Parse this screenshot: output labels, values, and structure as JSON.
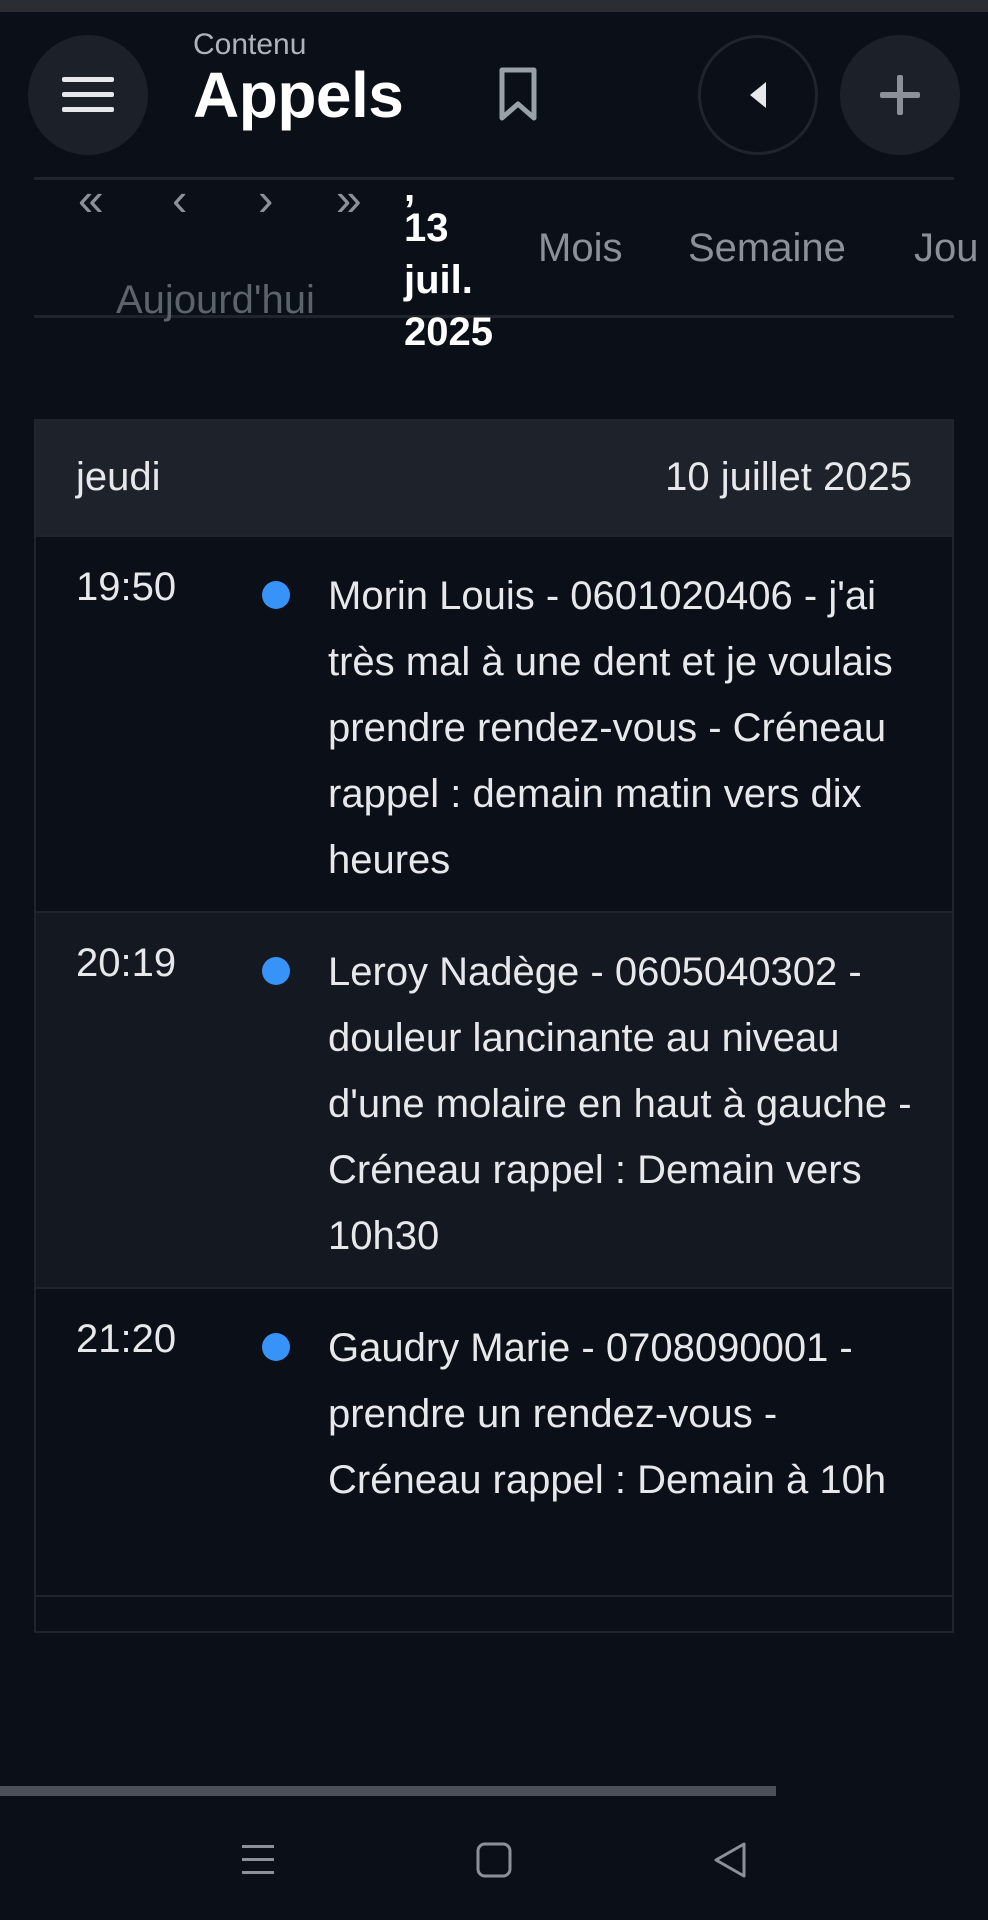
{
  "header": {
    "subtitle": "Contenu",
    "title": "Appels"
  },
  "calendar_toolbar": {
    "nav": {
      "prev_double": "«",
      "prev": "‹",
      "next": "›",
      "next_double": "»"
    },
    "today_label": "Aujourd'hui",
    "current_date_lines": [
      "13",
      "juil.",
      "2025"
    ],
    "views": [
      "Mois",
      "Semaine",
      "Jou"
    ]
  },
  "day": {
    "name": "jeudi",
    "date": "10 juillet 2025"
  },
  "events": [
    {
      "time": "19:50",
      "text": "Morin Louis - 0601020406 - j'ai très mal à une dent et je voulais prendre rendez-vous - Créneau rappel : demain matin vers dix heures"
    },
    {
      "time": "20:19",
      "text": "Leroy Nadège - 0605040302 - douleur lancinante au niveau d'une molaire en haut à gauche - Créneau rappel : Demain vers 10h30"
    },
    {
      "time": "21:20",
      "text": "Gaudry Marie - 0708090001 - prendre un rendez-vous - Créneau rappel : Demain à 10h"
    }
  ],
  "colors": {
    "background": "#0b0f17",
    "event_dot": "#3793f7",
    "header_row": "#1d222b"
  },
  "icons": {
    "menu": "hamburger-icon",
    "bookmark": "bookmark-icon",
    "back": "caret-left-icon",
    "add": "plus-icon",
    "system_nav": [
      "recents-icon",
      "home-icon",
      "back-triangle-icon"
    ]
  }
}
